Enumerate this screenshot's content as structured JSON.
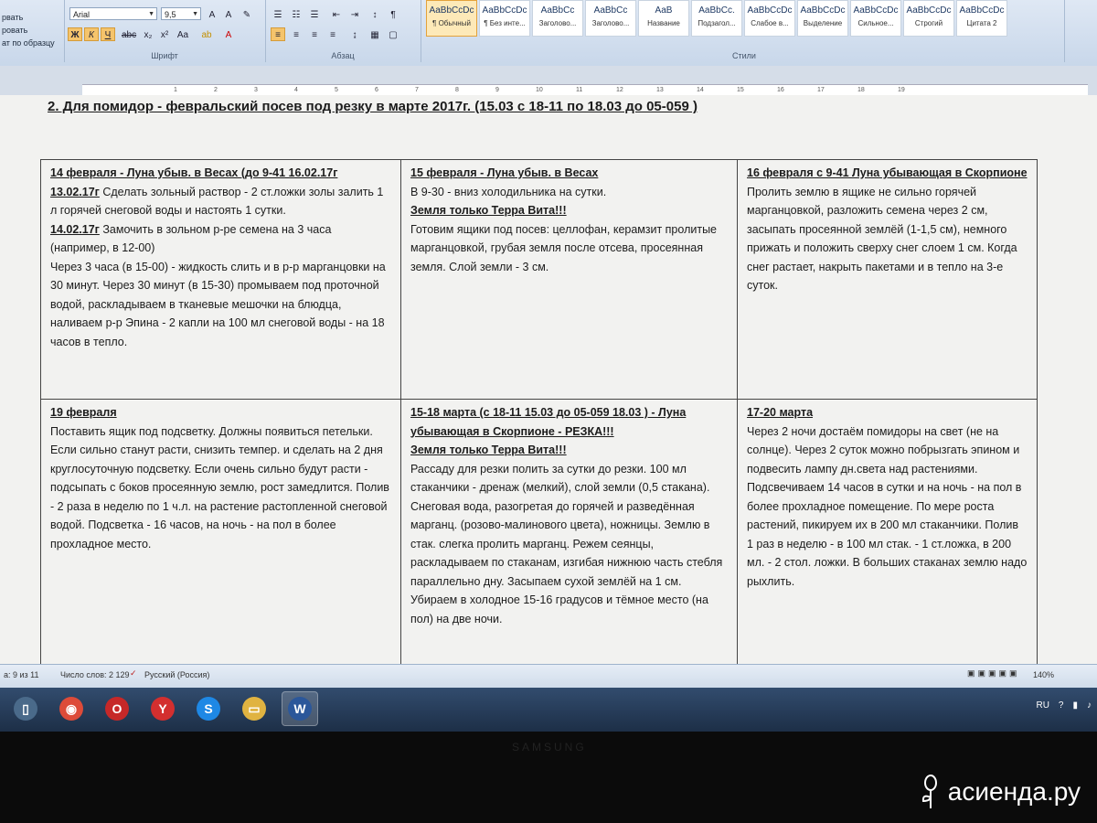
{
  "ribbon": {
    "clipboard_items": [
      "рвать",
      "ровать",
      "ат по образцу"
    ],
    "font_name": "Arial",
    "font_size": "9,5",
    "group_font": "Шрифт",
    "group_paragraph": "Абзац",
    "group_styles": "Стили",
    "styles": [
      {
        "sample": "AaBbCcDc",
        "name": "¶ Обычный",
        "selected": true
      },
      {
        "sample": "AaBbCcDc",
        "name": "¶ Без инте...",
        "selected": false
      },
      {
        "sample": "AaBbCc",
        "name": "Заголово...",
        "selected": false
      },
      {
        "sample": "AaBbCc",
        "name": "Заголово...",
        "selected": false
      },
      {
        "sample": "AaB",
        "name": "Название",
        "selected": false
      },
      {
        "sample": "AaBbCc.",
        "name": "Подзагол...",
        "selected": false
      },
      {
        "sample": "AaBbCcDc",
        "name": "Слабое в...",
        "selected": false
      },
      {
        "sample": "AaBbCcDc",
        "name": "Выделение",
        "selected": false
      },
      {
        "sample": "AaBbCcDc",
        "name": "Сильное...",
        "selected": false
      },
      {
        "sample": "AaBbCcDc",
        "name": "Строгий",
        "selected": false
      },
      {
        "sample": "AaBbCcDc",
        "name": "Цитата 2",
        "selected": false
      }
    ]
  },
  "ruler_ticks": [
    "1",
    "2",
    "3",
    "4",
    "5",
    "6",
    "7",
    "8",
    "9",
    "10",
    "11",
    "12",
    "13",
    "14",
    "15",
    "16",
    "17",
    "18",
    "19"
  ],
  "document": {
    "title": "2. Для помидор - февральский посев под резку в марте 2017г.   (15.03 с 18-11  по 18.03  до 05-059  )",
    "cells": [
      {
        "heading": "14 февраля  - Луна убыв. в Весах (до 9-41 16.02.17г",
        "lines": [
          {
            "label": "13.02.17г",
            "text": "  Сделать зольный раствор - 2 ст.ложки золы залить 1 л горячей снеговой воды и настоять 1 сутки."
          },
          {
            "label": "14.02.17г",
            "text": "  Замочить в зольном р-ре семена на 3 часа (например, в 12-00)"
          },
          {
            "label": "",
            "text": "Через 3 часа  (в 15-00) - жидкость слить и в р-р марганцовки на 30 минут. Через 30 минут (в 15-30) промываем под проточной  водой, раскладываем в тканевые мешочки на блюдца, наливаем р-р Эпина - 2 капли на 100 мл снеговой воды - на 18 часов в тепло."
          }
        ]
      },
      {
        "heading": "15 февраля  - Луна убыв. в Весах",
        "lines": [
          {
            "label": "",
            "text": "В 9-30 - вниз холодильника на сутки."
          },
          {
            "label": "Земля только Терра Вита!!!",
            "text": ""
          },
          {
            "label": "",
            "text": "Готовим ящики под посев: целлофан, керамзит пролитые  марганцовкой, грубая земля после отсева, просеянная земля. Слой земли - 3 см."
          }
        ]
      },
      {
        "heading": "16 февраля  с  9-41   Луна убывающая в Скорпионе",
        "lines": [
          {
            "label": "",
            "text": "Пролить землю в ящике не сильно горячей марганцовкой, разложить семена через 2 см, засыпать просеянной землёй (1-1,5 см), немного прижать и положить сверху снег слоем 1 см. Когда снег растает, накрыть пакетами и в тепло на 3-е суток."
          }
        ]
      },
      {
        "heading": "19  февраля",
        "lines": [
          {
            "label": "",
            "text": "Поставить ящик под подсветку. Должны появиться петельки. Если сильно станут расти, снизить темпер. и сделать на 2 дня круглосуточную подсветку. Если очень сильно будут расти - подсыпать с боков просеянную землю, рост замедлится.  Полив - 2 раза в неделю по 1 ч.л. на растение растопленной снеговой водой. Подсветка - 16 часов, на ночь - на пол в более прохладное место."
          }
        ]
      },
      {
        "heading": "15-18 марта (с 18-11 15.03 до 05-059 18.03 )  - Луна убывающая в Скорпионе   -   РЕЗКА!!!",
        "lines": [
          {
            "label": "Земля только Терра Вита!!!",
            "text": ""
          },
          {
            "label": "",
            "text": "Рассаду для резки полить за сутки до резки. 100  мл стаканчики - дренаж (мелкий), слой земли (0,5 стакана). Снеговая вода, разогретая до горячей и разведённая марганц. (розово-малинового цвета), ножницы. Землю в стак. слегка пролить  марганц. Режем сеянцы, раскладываем по стаканам, изгибая нижнюю часть стебля параллельно дну. Засыпаем сухой землёй на 1 см. Убираем в холодное  15-16 градусов и тёмное место (на пол) на две ночи."
          }
        ]
      },
      {
        "heading": "17-20 марта",
        "lines": [
          {
            "label": "",
            "text": "Через 2 ночи достаём помидоры  на свет (не на солнце). Через 2 суток можно побрызгать эпином и подвесить лампу дн.света над растениями. Подсвечиваем 14 часов в сутки и на ночь - на пол в более прохладное помещение. По мере роста растений, пикируем их в 200 мл стаканчики. Полив 1 раз в неделю  - в 100 мл стак. - 1 ст.ложка, в 200 мл. - 2 стол. ложки. В больших стаканах землю надо рыхлить."
          }
        ]
      }
    ]
  },
  "statusbar": {
    "page": "а: 9 из 11",
    "words": "Число слов: 2 129",
    "language": "Русский (Россия)",
    "zoom": "140%"
  },
  "taskbar": {
    "apps": [
      {
        "icon": "file-manager-icon",
        "glyph": "▯"
      },
      {
        "icon": "chrome-icon",
        "glyph": "◉"
      },
      {
        "icon": "opera-icon",
        "glyph": "O"
      },
      {
        "icon": "yandex-browser-icon",
        "glyph": "Y"
      },
      {
        "icon": "skype-icon",
        "glyph": "S"
      },
      {
        "icon": "folder-icon",
        "glyph": "▭"
      },
      {
        "icon": "word-icon",
        "glyph": "W"
      }
    ],
    "tray_lang": "RU"
  },
  "bezel": {
    "brand": "SAMSUNG"
  },
  "watermark": {
    "text": "асиенда.ру"
  },
  "colors": {
    "page": "#f2f2f0",
    "ribbon": "#dfe8f4",
    "taskbar": "#324c6e",
    "highlight": "#f5c46c"
  }
}
